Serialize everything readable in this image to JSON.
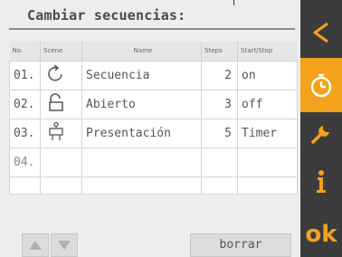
{
  "title": "Cambiar secuencias:",
  "table": {
    "headers": [
      "No.",
      "Scene",
      "Name",
      "Steps",
      "Start/Stop"
    ],
    "rows": [
      {
        "no": "01.",
        "icon": "rotate-arrow-icon",
        "name": "Secuencia",
        "steps": "2",
        "start_stop": "on"
      },
      {
        "no": "02.",
        "icon": "open-lock-icon",
        "name": "Abierto",
        "steps": "3",
        "start_stop": "off"
      },
      {
        "no": "03.",
        "icon": "presentation-icon",
        "name": "Presentación",
        "steps": "5",
        "start_stop": "Timer"
      },
      {
        "no": "04.",
        "icon": "",
        "name": "",
        "steps": "",
        "start_stop": ""
      }
    ]
  },
  "toolbar": {
    "up_icon": "arrow-up-icon",
    "down_icon": "arrow-down-icon",
    "delete_label": "borrar"
  },
  "sidebar": {
    "items": [
      {
        "icon": "back-arrow-icon",
        "active": false
      },
      {
        "icon": "stopwatch-icon",
        "active": true
      },
      {
        "icon": "wrench-icon",
        "active": false
      },
      {
        "icon": "info-icon",
        "active": false
      },
      {
        "icon": "ok-icon",
        "label": "ok",
        "active": false
      }
    ]
  },
  "colors": {
    "accent": "#f2a21b",
    "sidebar_bg": "#3c3c3c",
    "screen_bg": "#ededed"
  }
}
